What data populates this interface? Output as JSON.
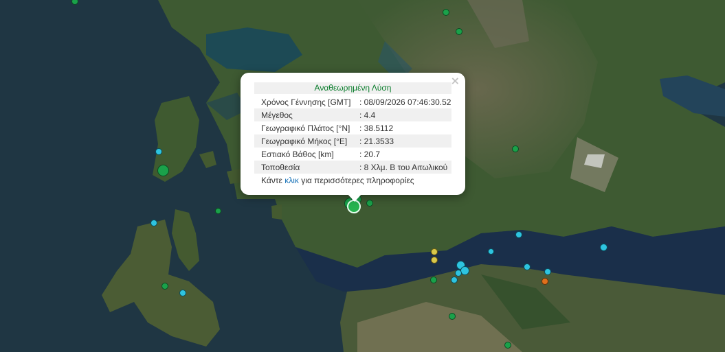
{
  "popup": {
    "title": "Αναθεωρημένη Λύση",
    "close": "×",
    "rows": [
      {
        "label": "Χρόνος Γέννησης [GMT]",
        "value": ": 08/09/2026 07:46:30.52"
      },
      {
        "label": "Μέγεθος",
        "value": ": 4.4"
      },
      {
        "label": "Γεωγραφικό Πλάτος [°N]",
        "value": ": 38.5112"
      },
      {
        "label": "Γεωγραφικό Μήκος [°E]",
        "value": ": 21.3533"
      },
      {
        "label": "Εστιακό Βάθος [km]",
        "value": ": 20.7"
      },
      {
        "label": "Τοποθεσία",
        "value": ": 8 Χλμ. Β του Αιτωλικού"
      }
    ],
    "more_prefix": "Κάντε ",
    "more_link": "κλικ",
    "more_suffix": " για περισσότερες πληροφορίες"
  },
  "marker_colors": {
    "green": "#1aa14a",
    "cyan": "#2ec4e0",
    "yellow": "#d9c84a",
    "orange": "#e0701c",
    "selected": "#27b34f"
  }
}
